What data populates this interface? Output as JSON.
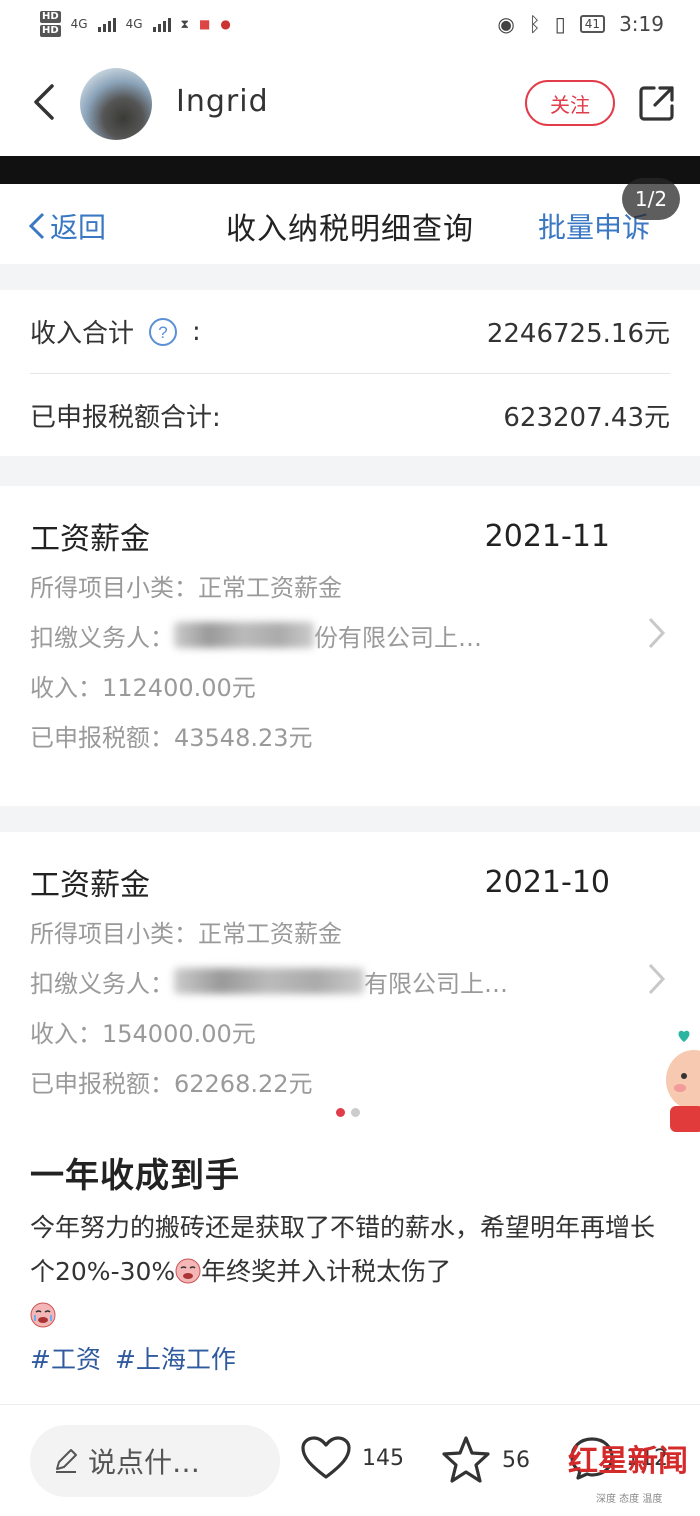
{
  "status_bar": {
    "time": "3:19",
    "battery": "41",
    "hd1": "HD",
    "hd2": "HD",
    "net1": "4G",
    "net2": "4G"
  },
  "header": {
    "username": "Ingrid",
    "follow_label": "关注"
  },
  "image_counter": "1/2",
  "shot": {
    "back_label": "返回",
    "title": "收入纳税明细查询",
    "right_action": "批量申诉",
    "summary": {
      "income_label": "收入合计",
      "income_colon": ":",
      "income_value": "2246725.16元",
      "tax_label": "已申报税额合计:",
      "tax_value": "623207.43元"
    },
    "records": [
      {
        "type": "工资薪金",
        "date": "2021-11",
        "subcategory": "所得项目小类：正常工资薪金",
        "withholder_label": "扣缴义务人：",
        "withholder_visible": "份有限公司上…",
        "income": "收入：112400.00元",
        "tax": "已申报税额：43548.23元"
      },
      {
        "type": "工资薪金",
        "date": "2021-10",
        "subcategory": "所得项目小类：正常工资薪金",
        "withholder_label": "扣缴义务人：",
        "withholder_visible": "有限公司上…",
        "income": "收入：154000.00元",
        "tax": "已申报税额：62268.22元"
      }
    ]
  },
  "post": {
    "title": "一年收成到手",
    "body_part1": "今年努力的搬砖还是获取了不错的薪水，希望明年再增长个20%-30%",
    "body_part2": "年终奖并入计税太伤了",
    "tags": [
      "#工资",
      "#上海工作"
    ]
  },
  "bottom_bar": {
    "comment_placeholder": "说点什…",
    "likes": "145",
    "favorites": "56",
    "comments": "112"
  },
  "watermark": {
    "text": "红星新闻",
    "sub": "深度 态度 温度"
  },
  "colors": {
    "accent_red": "#e23b4a",
    "link_blue": "#3a78c4",
    "tag_blue": "#2f5a9e"
  }
}
